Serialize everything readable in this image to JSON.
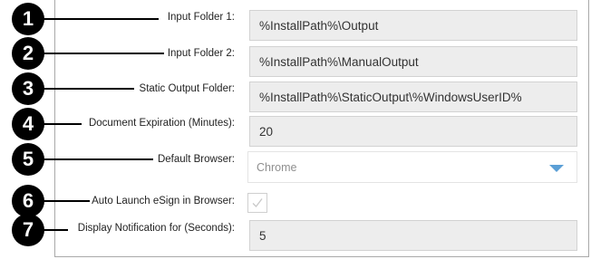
{
  "settings": {
    "badges": [
      "1",
      "2",
      "3",
      "4",
      "5",
      "6",
      "7"
    ],
    "input_folder_1": {
      "label": "Input Folder 1:",
      "value": "%InstallPath%\\Output"
    },
    "input_folder_2": {
      "label": "Input Folder 2:",
      "value": "%InstallPath%\\ManualOutput"
    },
    "static_output_folder": {
      "label": "Static Output Folder:",
      "value": "%InstallPath%\\StaticOutput\\%WindowsUserID%"
    },
    "document_expiration": {
      "label": "Document Expiration (Minutes):",
      "value": "20"
    },
    "default_browser": {
      "label": "Default Browser:",
      "selected": "Chrome"
    },
    "auto_launch_esign": {
      "label": "Auto Launch eSign in Browser:",
      "checked": true
    },
    "display_notification": {
      "label": "Display Notification for (Seconds):",
      "value": "5"
    }
  },
  "colors": {
    "badge": "#000000",
    "field_background": "#ededed",
    "dropdown_caret": "#5b9fd6",
    "checkmark": "#c8c8c8"
  },
  "icons": {
    "dropdown": "chevron-down-icon",
    "checkbox": "checkmark-icon"
  }
}
